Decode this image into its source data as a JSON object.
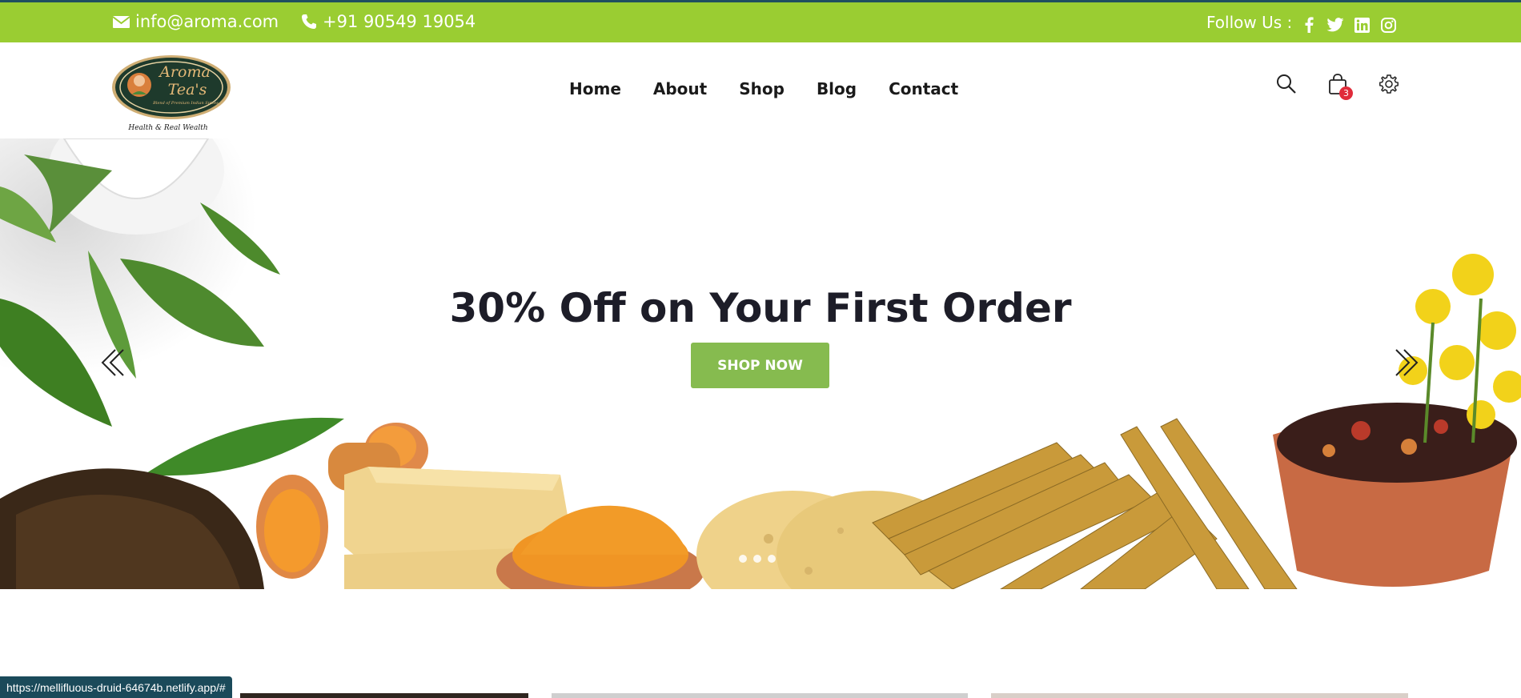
{
  "topbar": {
    "email": "info@aroma.com",
    "phone": "+91 90549 19054",
    "follow_label": "Follow Us :",
    "socials": [
      "facebook-icon",
      "twitter-icon",
      "linkedin-icon",
      "instagram-icon"
    ]
  },
  "logo": {
    "line1": "Aroma",
    "line2": "Tea's",
    "tagline": "Blend of Premium Indian Spices",
    "motto": "Health & Real Wealth"
  },
  "nav": {
    "items": [
      {
        "label": "Home"
      },
      {
        "label": "About"
      },
      {
        "label": "Shop"
      },
      {
        "label": "Blog"
      },
      {
        "label": "Contact"
      }
    ]
  },
  "header_icons": {
    "search": "search-icon",
    "cart": "shopping-bag-icon",
    "cart_count": "3",
    "settings": "gear-icon"
  },
  "hero": {
    "title": "30% Off on Your First Order",
    "button": "SHOP NOW",
    "slides": 3,
    "active_slide": 1
  },
  "status_url": "https://mellifluous-druid-64674b.netlify.app/#",
  "colors": {
    "topbar": "#9acd32",
    "button": "#86bb4f",
    "badge": "#e02b3a",
    "statusbar": "#1b4a5a"
  }
}
